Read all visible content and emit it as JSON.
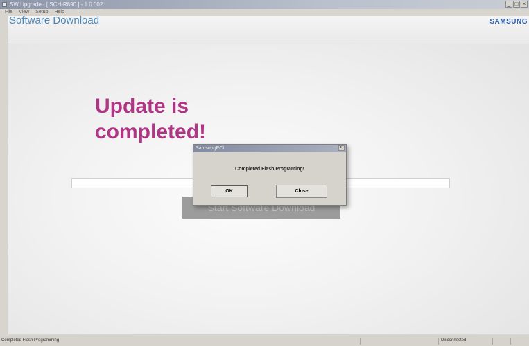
{
  "window": {
    "title": "SW Upgrade - [ SCH-R890 ] - 1.0.002",
    "minimize": "_",
    "maximize": "□",
    "close": "×"
  },
  "menu": {
    "items": [
      "File",
      "View",
      "Setup",
      "Help"
    ]
  },
  "app": {
    "title": "Software Download",
    "brand": "SAMSUNG"
  },
  "main": {
    "headline_line1": "Update is",
    "headline_line2": "completed!",
    "progress": 0,
    "start_button": "Start Software Download"
  },
  "dialog": {
    "title": "SamsungPCI",
    "close": "×",
    "message": "Completed Flash Programing!",
    "ok": "OK",
    "close_button": "Close"
  },
  "status": {
    "left": "Completed Flash Programming",
    "right": "Disconnected"
  },
  "colors": {
    "headline": "#b03584",
    "title": "#4a86b8",
    "brand": "#2e5fa8"
  }
}
